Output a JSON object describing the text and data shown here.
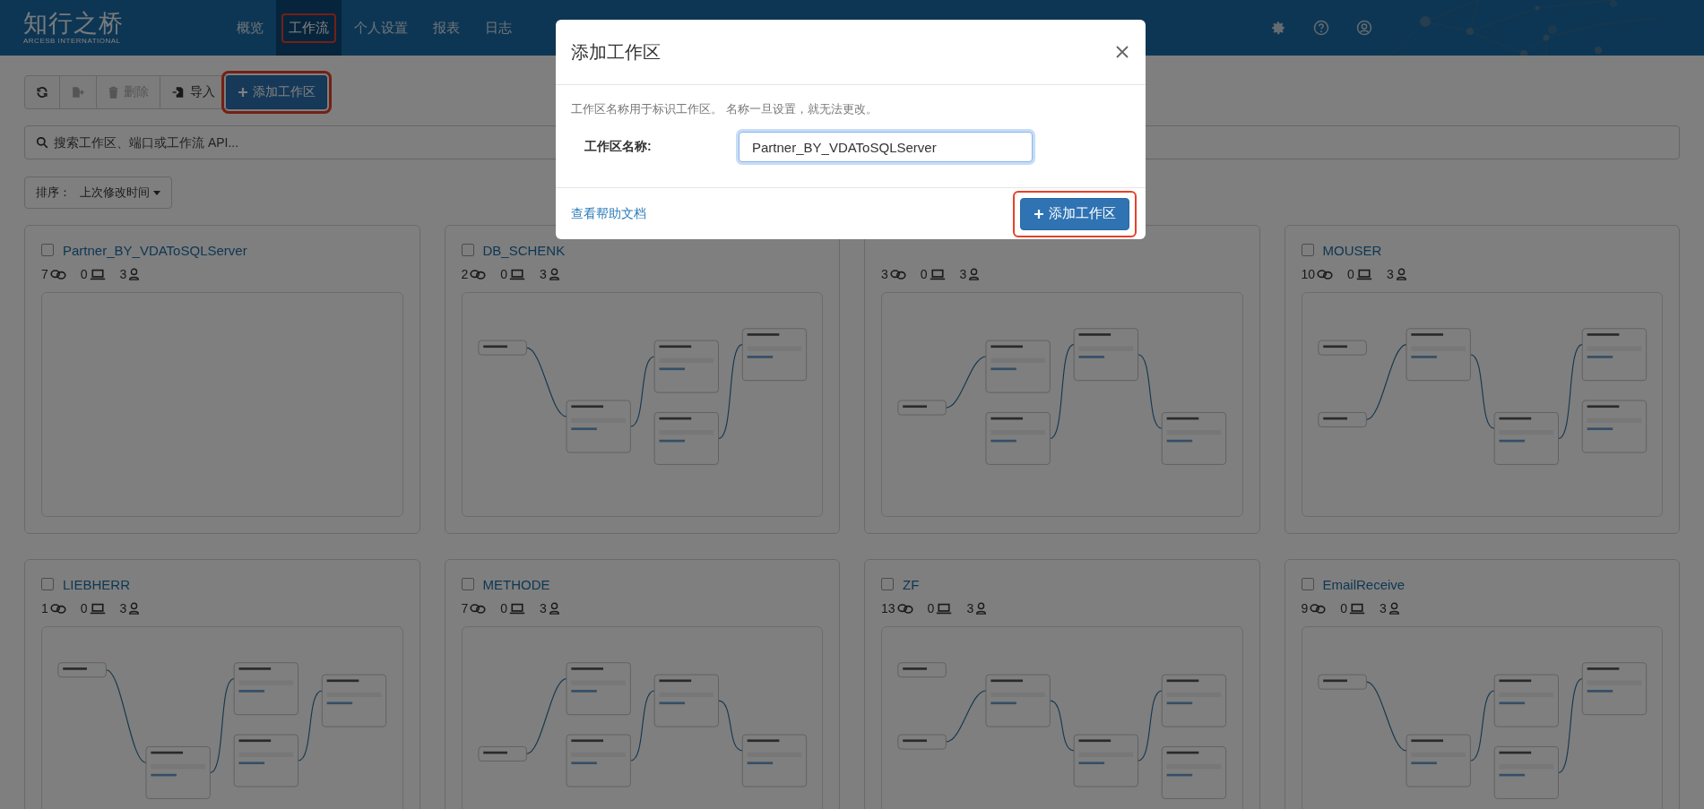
{
  "header": {
    "logo": {
      "name": "知行之桥",
      "tagline": "ARCESB INTERNATIONAL"
    },
    "nav": [
      {
        "label": "概览",
        "selected": false,
        "highlighted": false
      },
      {
        "label": "工作流",
        "selected": true,
        "highlighted": true
      },
      {
        "label": "个人设置",
        "selected": false,
        "highlighted": false
      },
      {
        "label": "报表",
        "selected": false,
        "highlighted": false
      },
      {
        "label": "日志",
        "selected": false,
        "highlighted": false
      }
    ]
  },
  "toolbar": [
    {
      "kind": "refresh",
      "disabled": false,
      "highlighted": false
    },
    {
      "kind": "export",
      "disabled": true,
      "highlighted": false
    },
    {
      "kind": "delete",
      "label": "删除",
      "disabled": true,
      "highlighted": false
    },
    {
      "kind": "import",
      "label": "导入",
      "disabled": false,
      "highlighted": false
    },
    {
      "kind": "add",
      "label": "添加工作区",
      "disabled": false,
      "highlighted": true
    }
  ],
  "search": {
    "placeholder": "搜索工作区、端口或工作流 API..."
  },
  "sort": {
    "label": "排序：",
    "value": "上次修改时间"
  },
  "workspaces": [
    {
      "name": "Partner_BY_VDAToSQLServer",
      "checked": false,
      "flows": "7",
      "ports": "0",
      "users": "3",
      "diagram": false
    },
    {
      "name": "DB_SCHENK",
      "checked": false,
      "flows": "2",
      "ports": "0",
      "users": "3",
      "diagram": true
    },
    {
      "flows": "3",
      "ports": "0",
      "users": "3",
      "diagram": true
    },
    {
      "name": "MOUSER",
      "checked": false,
      "flows": "10",
      "ports": "0",
      "users": "3",
      "diagram": true
    },
    {
      "name": "LIEBHERR",
      "checked": false,
      "flows": "1",
      "ports": "0",
      "users": "3",
      "diagram": true
    },
    {
      "name": "METHODE",
      "checked": false,
      "flows": "7",
      "ports": "0",
      "users": "3",
      "diagram": true
    },
    {
      "name": "ZF",
      "checked": false,
      "flows": "13",
      "ports": "0",
      "users": "3",
      "diagram": true
    },
    {
      "name": "EmailReceive",
      "checked": false,
      "flows": "9",
      "ports": "0",
      "users": "3",
      "diagram": true
    }
  ],
  "dialog": {
    "title": "添加工作区",
    "description": "工作区名称用于标识工作区。 名称一旦设置，就无法更改。",
    "field_label": "工作区名称:",
    "field_value": "Partner_BY_VDAToSQLServer",
    "help_link": "查看帮助文档",
    "submit": {
      "label": "添加工作区",
      "highlighted": true
    }
  }
}
